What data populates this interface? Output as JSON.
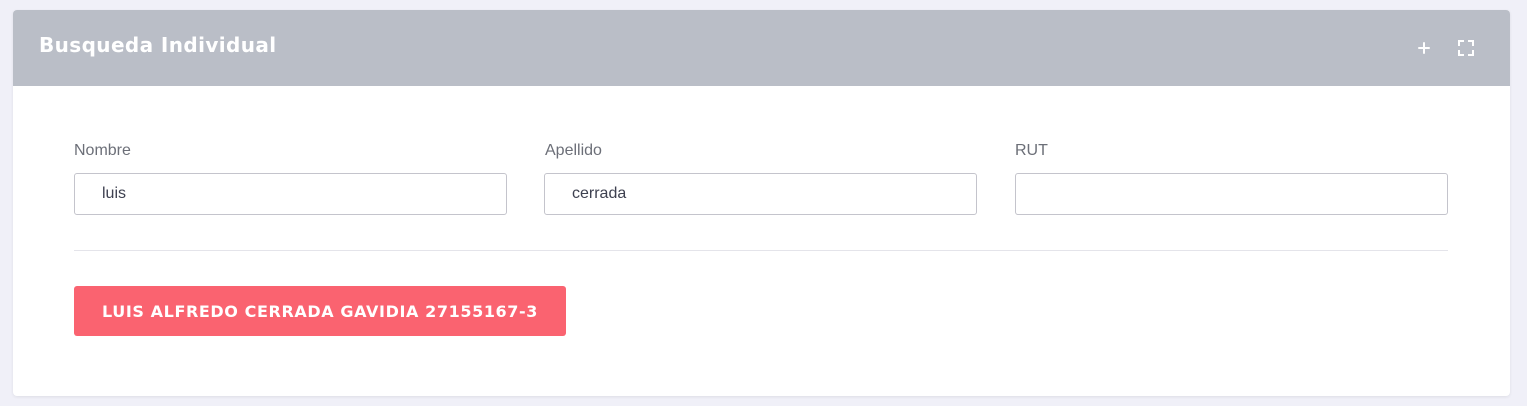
{
  "panel": {
    "title": "Busqueda Individual",
    "actions": [
      {
        "icon": "plus-icon"
      },
      {
        "icon": "fullscreen-icon"
      }
    ]
  },
  "form": {
    "fields": [
      {
        "label": "Nombre",
        "value": "luis"
      },
      {
        "label": "Apellido",
        "value": "cerrada"
      },
      {
        "label": "RUT",
        "value": ""
      }
    ]
  },
  "results": [
    {
      "label": "LUIS ALFREDO CERRADA GAVIDIA 27155167-3"
    }
  ],
  "colors": {
    "header_bg": "#babec7",
    "result_button": "#fa6370",
    "page_bg": "#f0f0f8"
  }
}
